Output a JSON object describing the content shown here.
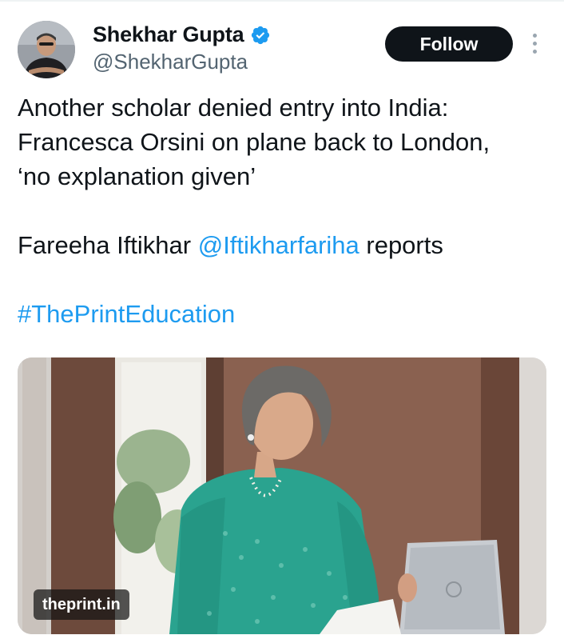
{
  "author": {
    "name": "Shekhar Gupta",
    "handle": "@ShekharGupta",
    "verified_icon": "verified-badge-icon",
    "avatar_icon": "user-avatar"
  },
  "follow_button": {
    "label": "Follow"
  },
  "more_menu": {
    "icon": "more-vertical-icon"
  },
  "tweet": {
    "line1": "Another scholar denied entry into India:",
    "line2": "Francesca Orsini on plane back to London,",
    "line3": "‘no explanation given’",
    "byline_prefix": "Fareeha Iftikhar ",
    "mention": "@Iftikharfariha",
    "byline_suffix": " reports",
    "hashtag": "#ThePrintEducation"
  },
  "media": {
    "source_label": "theprint.in"
  },
  "colors": {
    "link": "#1d9bf0",
    "text": "#0f1419",
    "secondary": "#536471",
    "button_bg": "#0f1419"
  }
}
